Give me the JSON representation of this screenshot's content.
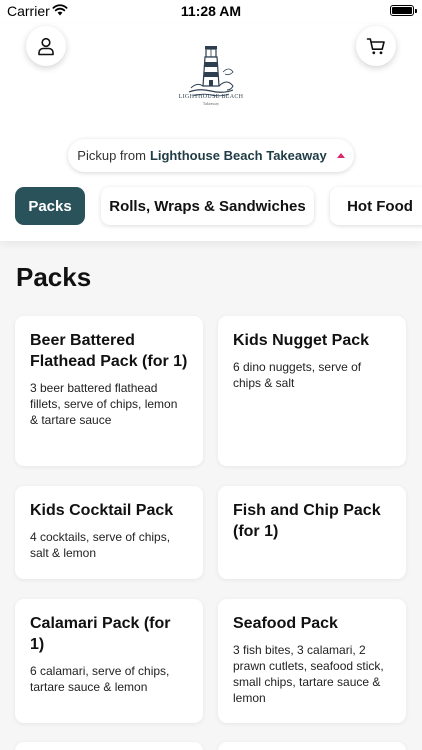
{
  "status_bar": {
    "carrier": "Carrier",
    "time": "11:28 AM"
  },
  "header": {
    "logo_text": "LIGHTHOUSE BEACH",
    "logo_subtext": "Takeaway"
  },
  "pickup": {
    "prefix": "Pickup from",
    "store": "Lighthouse Beach Takeaway"
  },
  "categories": [
    {
      "label": "Packs",
      "active": true
    },
    {
      "label": "Rolls, Wraps & Sandwiches",
      "active": false
    },
    {
      "label": "Hot Food",
      "active": false
    }
  ],
  "section": {
    "title": "Packs"
  },
  "products": [
    {
      "name": "Beer Battered Flathead Pack (for 1)",
      "description": "3 beer battered flathead fillets, serve of chips, lemon & tartare sauce"
    },
    {
      "name": "Kids Nugget Pack",
      "description": "6 dino nuggets, serve of chips & salt"
    },
    {
      "name": "Kids Cocktail Pack",
      "description": "4 cocktails, serve of chips, salt & lemon"
    },
    {
      "name": "Fish and Chip Pack (for 1)",
      "description": ""
    },
    {
      "name": "Calamari Pack (for 1)",
      "description": "6 calamari, serve of chips, tartare sauce & lemon"
    },
    {
      "name": "Seafood Pack",
      "description": "3 fish bites, 3 calamari, 2 prawn cutlets, seafood stick, small chips, tartare sauce & lemon"
    }
  ],
  "colors": {
    "accent": "#2a525a",
    "caret": "#d62a6b"
  }
}
